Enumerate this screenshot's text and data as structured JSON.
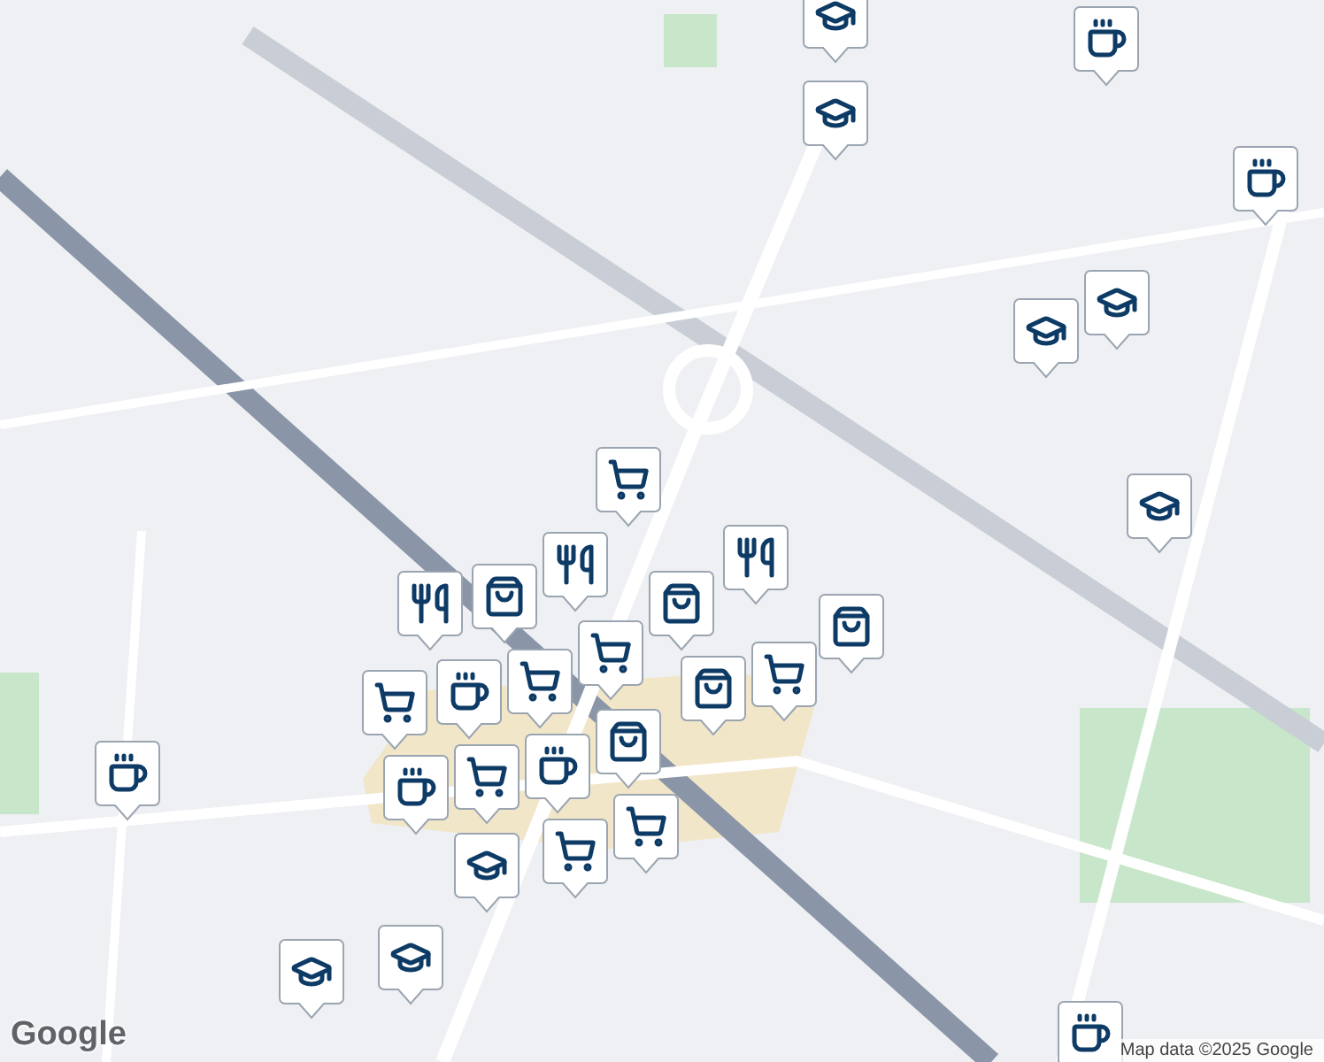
{
  "markers": [
    {
      "kind": "school"
    },
    {
      "kind": "coffee"
    },
    {
      "kind": "school"
    },
    {
      "kind": "coffee"
    },
    {
      "kind": "school"
    },
    {
      "kind": "school"
    },
    {
      "kind": "school"
    },
    {
      "kind": "cart"
    },
    {
      "kind": "restaurant"
    },
    {
      "kind": "restaurant"
    },
    {
      "kind": "bag"
    },
    {
      "kind": "bag"
    },
    {
      "kind": "bag"
    },
    {
      "kind": "cart"
    },
    {
      "kind": "bag"
    },
    {
      "kind": "restaurant"
    },
    {
      "kind": "cart"
    },
    {
      "kind": "coffee"
    },
    {
      "kind": "cart"
    },
    {
      "kind": "cart"
    },
    {
      "kind": "bag"
    },
    {
      "kind": "coffee"
    },
    {
      "kind": "cart"
    },
    {
      "kind": "coffee"
    },
    {
      "kind": "cart"
    },
    {
      "kind": "cart"
    },
    {
      "kind": "school"
    },
    {
      "kind": "coffee"
    },
    {
      "kind": "school"
    },
    {
      "kind": "school"
    },
    {
      "kind": "coffee"
    }
  ],
  "logo": "Google",
  "attribution": "Map data ©2025 Google"
}
